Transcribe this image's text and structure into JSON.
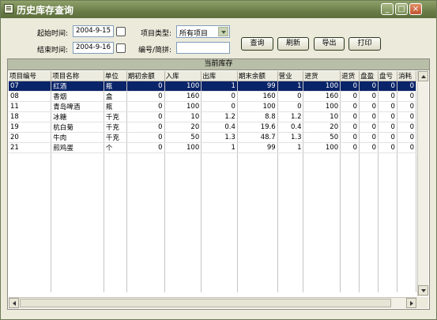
{
  "window": {
    "title": "历史库存查询",
    "minimize": "_",
    "maximize": "□",
    "close": "×"
  },
  "filters": {
    "start_label": "起始时间:",
    "start_value": "2004-9-15",
    "end_label": "结束时间:",
    "end_value": "2004-9-16",
    "type_label": "项目类型:",
    "type_value": "所有项目",
    "code_label": "编号/简拼:",
    "code_value": ""
  },
  "buttons": {
    "query": "查询",
    "refresh": "刷新",
    "export": "导出",
    "print": "打印"
  },
  "panel": {
    "title": "当前库存"
  },
  "table": {
    "columns": [
      "项目编号",
      "项目名称",
      "单位",
      "期初余额",
      "入库",
      "出库",
      "期末余额",
      "营业",
      "进货",
      "退货",
      "盘盈",
      "盘亏",
      "消耗"
    ],
    "selected_row": 0,
    "rows": [
      [
        "07",
        "红酒",
        "瓶",
        "0",
        "100",
        "1",
        "99",
        "1",
        "100",
        "0",
        "0",
        "0",
        "0"
      ],
      [
        "08",
        "香烟",
        "盒",
        "0",
        "160",
        "0",
        "160",
        "0",
        "160",
        "0",
        "0",
        "0",
        "0"
      ],
      [
        "11",
        "青岛啤酒",
        "瓶",
        "0",
        "100",
        "0",
        "100",
        "0",
        "100",
        "0",
        "0",
        "0",
        "0"
      ],
      [
        "18",
        "冰糖",
        "千克",
        "0",
        "10",
        "1.2",
        "8.8",
        "1.2",
        "10",
        "0",
        "0",
        "0",
        "0"
      ],
      [
        "19",
        "杭白菊",
        "千克",
        "0",
        "20",
        "0.4",
        "19.6",
        "0.4",
        "20",
        "0",
        "0",
        "0",
        "0"
      ],
      [
        "20",
        "牛肉",
        "千克",
        "0",
        "50",
        "1.3",
        "48.7",
        "1.3",
        "50",
        "0",
        "0",
        "0",
        "0"
      ],
      [
        "21",
        "煎鸡蛋",
        "个",
        "0",
        "100",
        "1",
        "99",
        "1",
        "100",
        "0",
        "0",
        "0",
        "0"
      ]
    ]
  }
}
